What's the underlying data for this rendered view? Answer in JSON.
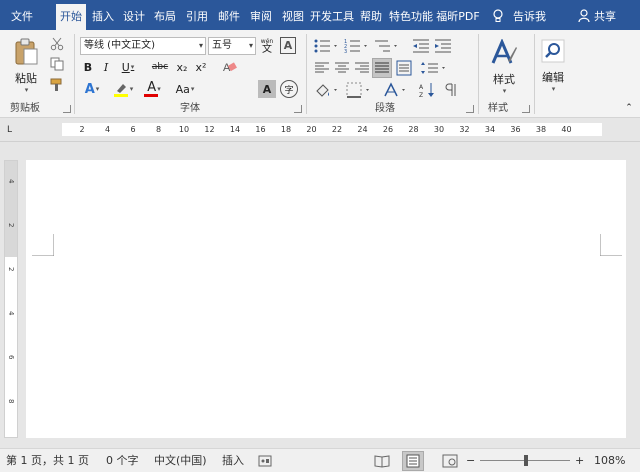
{
  "tabs": [
    {
      "label": "文件",
      "active": false
    },
    {
      "label": "开始",
      "active": true
    },
    {
      "label": "插入",
      "active": false
    },
    {
      "label": "设计",
      "active": false
    },
    {
      "label": "布局",
      "active": false
    },
    {
      "label": "引用",
      "active": false
    },
    {
      "label": "邮件",
      "active": false
    },
    {
      "label": "审阅",
      "active": false
    },
    {
      "label": "视图",
      "active": false
    },
    {
      "label": "开发工具",
      "active": false
    },
    {
      "label": "帮助",
      "active": false
    },
    {
      "label": "特色功能",
      "active": false
    },
    {
      "label": "福昕PDF",
      "active": false
    }
  ],
  "tell_me": "告诉我",
  "share": "共享",
  "clipboard": {
    "paste": "粘贴",
    "group": "剪贴板"
  },
  "font": {
    "name": "等线 (中文正文)",
    "size": "五号",
    "group": "字体",
    "bold": "B",
    "italic": "I",
    "underline": "U",
    "strike": "abc",
    "subscript": "x₂",
    "superscript": "x²",
    "font_color_letter": "A",
    "case": "Aa",
    "phonetic": "wén",
    "char_border": "A",
    "enclose": "字"
  },
  "paragraph": {
    "group": "段落"
  },
  "styles": {
    "label": "样式",
    "group": "样式"
  },
  "editing": {
    "label": "编辑"
  },
  "ruler_ticks": [
    "2",
    "4",
    "6",
    "8",
    "10",
    "12",
    "14",
    "16",
    "18",
    "20",
    "22",
    "24",
    "26",
    "28",
    "30",
    "32",
    "34",
    "36",
    "38",
    "40"
  ],
  "ruler_tab": "L",
  "vruler_ticks": [
    "4",
    "2",
    "2",
    "4",
    "6",
    "8"
  ],
  "status": {
    "page": "第 1 页，共 1 页",
    "words": "0 个字",
    "lang": "中文(中国)",
    "mode": "插入",
    "zoom": "108%",
    "zoom_level": 1.08
  },
  "colors": {
    "accent": "#2b579a",
    "highlight": "#ffff00",
    "font_color": "#e00000"
  }
}
